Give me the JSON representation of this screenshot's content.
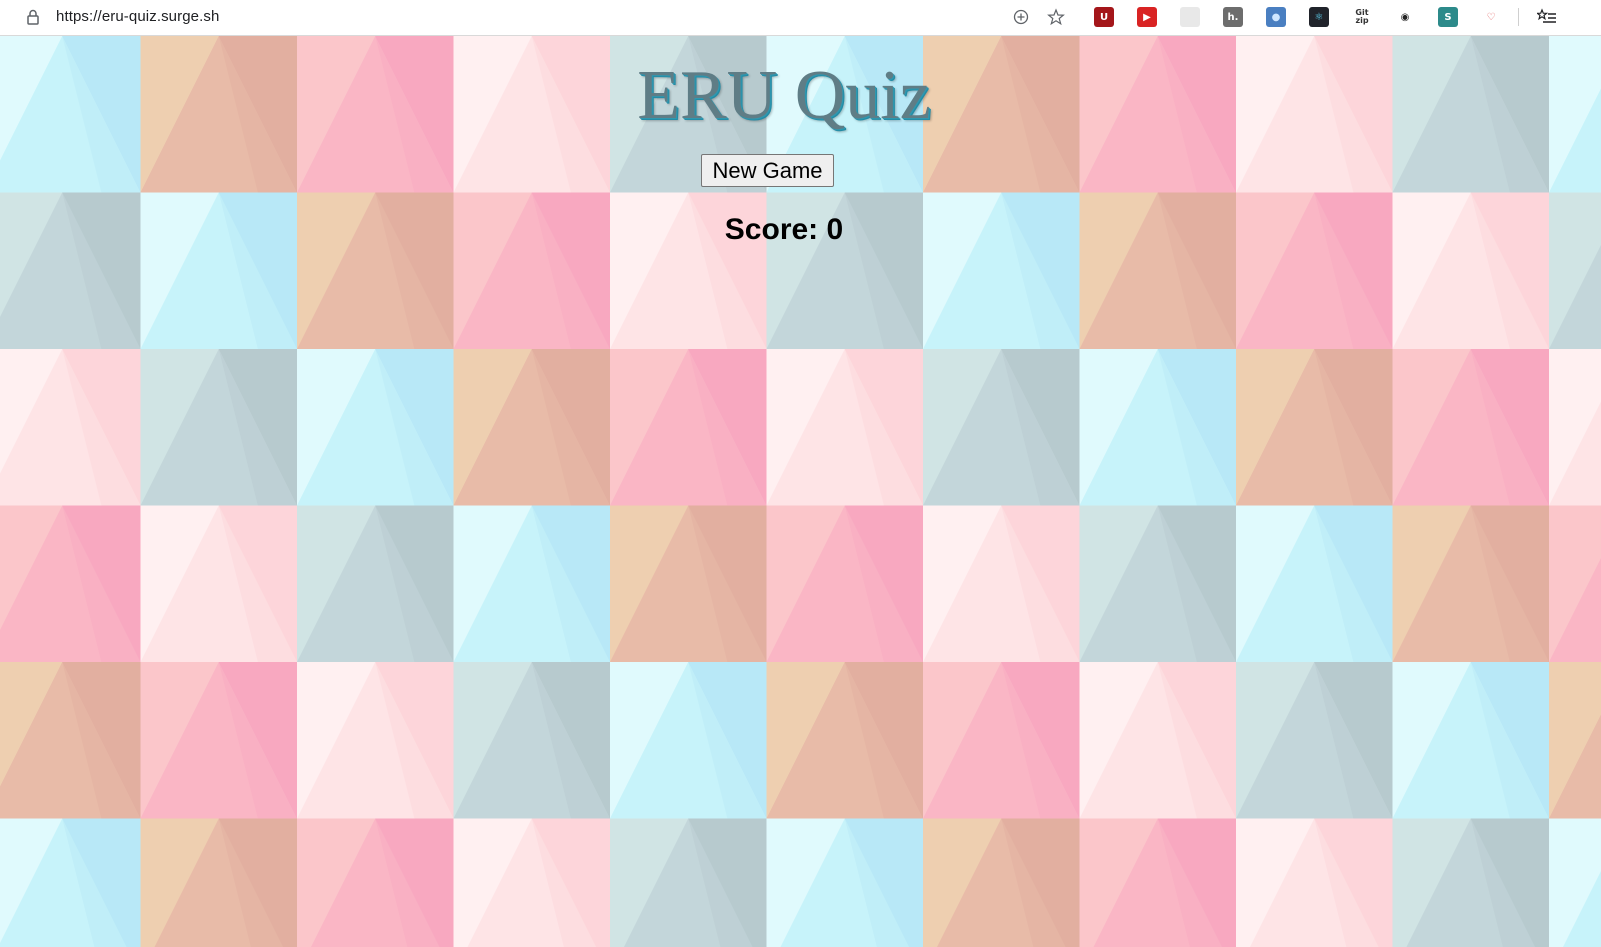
{
  "browser": {
    "url": "https://eru-quiz.surge.sh",
    "icons": [
      "lock-icon",
      "add-to-home-icon",
      "bookmark-star-icon"
    ],
    "extensions": [
      {
        "name": "ublock-extension-icon",
        "glyph": "U",
        "color": "#a4161a",
        "fg": "#ffffff"
      },
      {
        "name": "youtube-extension-icon",
        "glyph": "▶",
        "color": "#d92323",
        "fg": "#ffffff"
      },
      {
        "name": "document-extension-icon",
        "glyph": "",
        "color": "#e8e8e8",
        "fg": "#666666"
      },
      {
        "name": "h-extension-icon",
        "glyph": "h.",
        "color": "#6d6d6d",
        "fg": "#ffffff"
      },
      {
        "name": "ie-tab-extension-icon",
        "glyph": "●",
        "color": "#4a7fc1",
        "fg": "#cfe6ff"
      },
      {
        "name": "react-devtools-icon",
        "glyph": "⚛",
        "color": "#20232a",
        "fg": "#61dafb"
      },
      {
        "name": "gitzip-extension-icon",
        "glyph": "Git zip",
        "color": "#ffffff",
        "fg": "#333333"
      },
      {
        "name": "chrome-circle-extension-icon",
        "glyph": "◉",
        "color": "#ffffff",
        "fg": "#222222"
      },
      {
        "name": "s-extension-icon",
        "glyph": "S",
        "color": "#2c8a8a",
        "fg": "#ffffff"
      },
      {
        "name": "red-outline-extension-icon",
        "glyph": "♡",
        "color": "#ffffff",
        "fg": "#e06060"
      }
    ],
    "reading_list_icon": "reading-list-icon"
  },
  "page": {
    "title": "ERU Quiz",
    "new_game_label": "New Game",
    "score_label": "Score:",
    "score_value": "0"
  },
  "background": {
    "palettes": {
      "blue": [
        "#e0fafd",
        "#c7f3fa",
        "#b8e8f7"
      ],
      "peach": [
        "#eecfb0",
        "#e8bba8",
        "#e2afa0"
      ],
      "pink": [
        "#fbc6ca",
        "#fab6c5",
        "#f8a8c0"
      ],
      "lightpink": [
        "#fff0f1",
        "#fee4e6",
        "#fdd5da"
      ],
      "gray": [
        "#d0e4e4",
        "#c3d6da",
        "#b7cace"
      ]
    },
    "row_patterns": [
      [
        "blue",
        "peach",
        "pink",
        "lightpink",
        "gray"
      ],
      [
        "gray",
        "blue",
        "peach",
        "pink",
        "lightpink"
      ],
      [
        "lightpink",
        "gray",
        "blue",
        "peach",
        "pink"
      ],
      [
        "pink",
        "lightpink",
        "gray",
        "blue",
        "peach"
      ],
      [
        "peach",
        "pink",
        "lightpink",
        "gray",
        "blue"
      ]
    ]
  }
}
